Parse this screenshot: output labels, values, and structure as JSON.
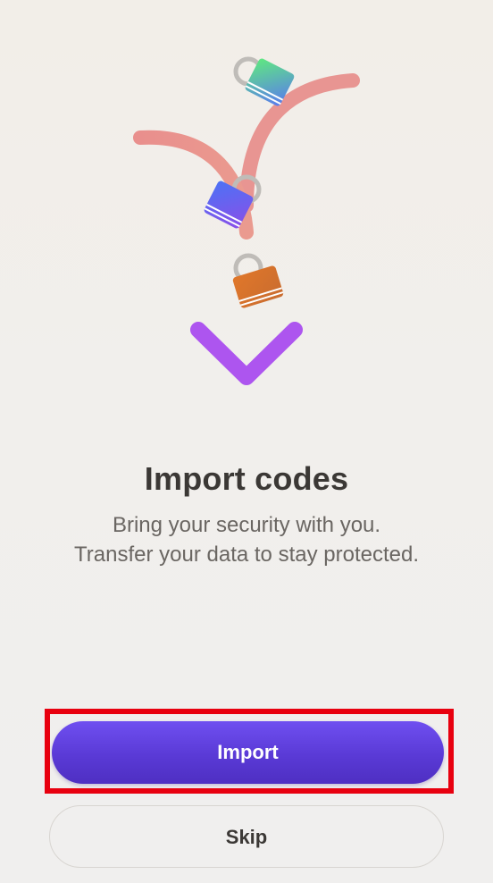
{
  "onboarding": {
    "title": "Import codes",
    "subtitle_line1": "Bring your security with you.",
    "subtitle_line2": "Transfer your data to stay protected."
  },
  "actions": {
    "import_label": "Import",
    "skip_label": "Skip"
  },
  "illustration": {
    "icon": "branching-arrow-with-padlocks-icon",
    "colors": {
      "branch": "#e89592",
      "arrow": "#ad55ef",
      "lock_green": "#4fd99a",
      "lock_blue": "#5b6ef0",
      "lock_orange": "#d9772e",
      "shackle": "#bfbcb8"
    }
  },
  "colors": {
    "primary_button": "#5a3ad6",
    "highlight": "#e8000f",
    "title_text": "#3b3835",
    "body_text": "#6a6662"
  }
}
